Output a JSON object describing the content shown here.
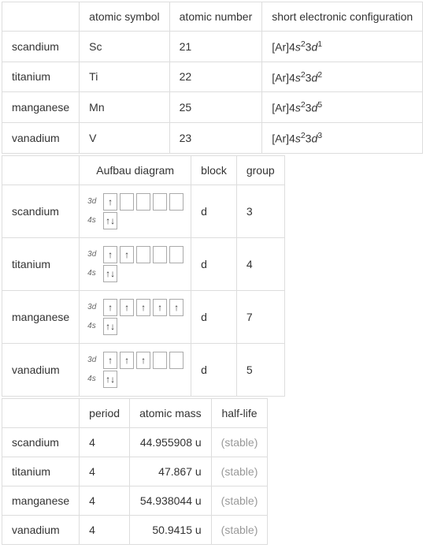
{
  "table1": {
    "headers": {
      "symbol": "atomic symbol",
      "number": "atomic number",
      "config": "short electronic configuration"
    },
    "rows": [
      {
        "name": "scandium",
        "symbol": "Sc",
        "number": "21",
        "config_prefix": "[Ar]4",
        "config_s": "s",
        "config_s_sup": "2",
        "config_d": "3",
        "config_dl": "d",
        "config_d_sup": "1"
      },
      {
        "name": "titanium",
        "symbol": "Ti",
        "number": "22",
        "config_prefix": "[Ar]4",
        "config_s": "s",
        "config_s_sup": "2",
        "config_d": "3",
        "config_dl": "d",
        "config_d_sup": "2"
      },
      {
        "name": "manganese",
        "symbol": "Mn",
        "number": "25",
        "config_prefix": "[Ar]4",
        "config_s": "s",
        "config_s_sup": "2",
        "config_d": "3",
        "config_dl": "d",
        "config_d_sup": "5"
      },
      {
        "name": "vanadium",
        "symbol": "V",
        "number": "23",
        "config_prefix": "[Ar]4",
        "config_s": "s",
        "config_s_sup": "2",
        "config_d": "3",
        "config_dl": "d",
        "config_d_sup": "3"
      }
    ]
  },
  "table2": {
    "headers": {
      "aufbau": "Aufbau diagram",
      "block": "block",
      "group": "group"
    },
    "label_3d": "3d",
    "label_4s": "4s",
    "rows": [
      {
        "name": "scandium",
        "d_electrons": 1,
        "block": "d",
        "group": "3"
      },
      {
        "name": "titanium",
        "d_electrons": 2,
        "block": "d",
        "group": "4"
      },
      {
        "name": "manganese",
        "d_electrons": 5,
        "block": "d",
        "group": "7"
      },
      {
        "name": "vanadium",
        "d_electrons": 3,
        "block": "d",
        "group": "5"
      }
    ]
  },
  "table3": {
    "headers": {
      "period": "period",
      "mass": "atomic mass",
      "halflife": "half-life"
    },
    "rows": [
      {
        "name": "scandium",
        "period": "4",
        "mass": "44.955908 u",
        "halflife": "(stable)"
      },
      {
        "name": "titanium",
        "period": "4",
        "mass": "47.867 u",
        "halflife": "(stable)"
      },
      {
        "name": "manganese",
        "period": "4",
        "mass": "54.938044 u",
        "halflife": "(stable)"
      },
      {
        "name": "vanadium",
        "period": "4",
        "mass": "50.9415 u",
        "halflife": "(stable)"
      }
    ]
  }
}
